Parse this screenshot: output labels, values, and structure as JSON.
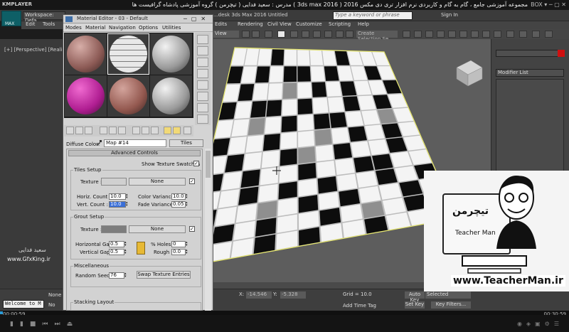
{
  "kmplayer": {
    "logo": "KMPLAYER",
    "caption": "مجموعه آموزشی جامع ، گام به گام و کاربردی نرم افزار تری دی مکس 2016  ( 3ds max 2016 )  مدرس : سعید فدایی ( تیچرمن ) گروه آموزشی پادشاه گرافیست ها",
    "controls": "BOX",
    "time_left": "00:00:59",
    "time_right": "00:30:59"
  },
  "max": {
    "workspace": "Workspace: Defa",
    "app_title": "...desk 3ds Max 2016   Untitled",
    "search_placeholder": "Type a keyword or phrase",
    "sign_in": "Sign In",
    "menus": [
      "Edit",
      "Tools",
      "Edits",
      "Rendering",
      "Civil View",
      "Customize",
      "Scripting",
      "Help"
    ],
    "view_drop": "View",
    "selection_set": "Create Selection Se",
    "viewport_label": "[+] [Perspective] [Realist",
    "modifier_list": "Modifier List",
    "status": {
      "none": "None",
      "no": "No",
      "x_label": "X:",
      "x_value": "-14.546",
      "y_label": "Y:",
      "y_value": "-5.328",
      "grid": "Grid = 10.0",
      "add_time_tag": "Add Time Tag",
      "auto_key": "Auto Key",
      "selected": "Selected",
      "set_key": "Set Key",
      "key_filters": "Key Filters...",
      "welcome": "Welcome to M"
    }
  },
  "material_editor": {
    "title": "Material Editor - 03 - Default",
    "menus": [
      "Modes",
      "Material",
      "Navigation",
      "Options",
      "Utilities"
    ],
    "diffuse_label": "Diffuse Color:",
    "map_name": "Map #14",
    "map_type": "Tiles",
    "advanced_controls": "Advanced Controls",
    "show_swatches": "Show Texture Swatches",
    "tiles_setup": {
      "title": "Tiles Setup",
      "texture_label": "Texture :",
      "none": "None",
      "horiz_count_label": "Horiz. Count :",
      "horiz_count": "10.0",
      "vert_count_label": "Vert. Count :",
      "vert_count": "10.0",
      "color_variance_label": "Color Variance :",
      "color_variance": "10.0",
      "fade_variance_label": "Fade Variance :",
      "fade_variance": "0.05"
    },
    "grout_setup": {
      "title": "Grout Setup",
      "texture_label": "Texture :",
      "none": "None",
      "horizontal_gap_label": "Horizontal Gap :",
      "horizontal_gap": "0.5",
      "vertical_gap_label": "Vertical Gap :",
      "vertical_gap": "0.5",
      "holes_label": "% Holes :",
      "holes": "0",
      "rough_label": "Rough :",
      "rough": "0.0"
    },
    "misc": {
      "title": "Miscellaneous",
      "random_seed_label": "Random Seed :",
      "random_seed": "76",
      "swap_button": "Swap Texture Entries"
    },
    "stacking": "Stacking Layout"
  },
  "watermark": {
    "left_name": "سعید فدایی",
    "left_site": "www.GfxKing.ir",
    "persian": "تیچرمن",
    "teacher": "Teacher Man",
    "url": "www.TeacherMan.ir"
  },
  "colors": {
    "accent": "#0e5f66",
    "tile_dark": "#0d0d0d",
    "tile_light": "#f4f4f4",
    "tile_mid": "#8f8f8f",
    "grout": "#bdbdbd",
    "highlight": "#3a6fd8"
  }
}
